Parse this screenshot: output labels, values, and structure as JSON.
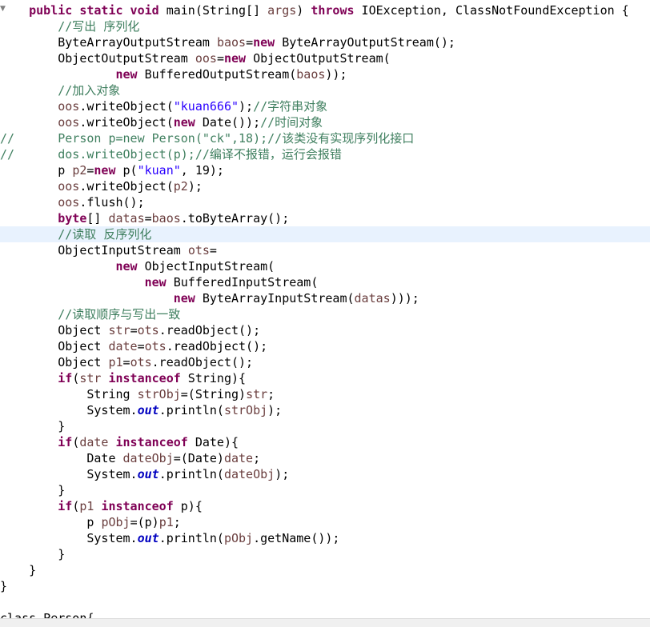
{
  "editor": {
    "fold_icon": "collapse-triangle-icon",
    "current_line": 14,
    "colors": {
      "keyword": "#7f0055",
      "comment": "#3f7f5f",
      "string": "#2a00ff",
      "local_variable": "#6a3e3e",
      "static_field": "#0000c0",
      "current_line_bg": "#e8f2fe"
    },
    "lines": [
      [
        [
          "    ",
          "p"
        ],
        [
          "public static void",
          "k"
        ],
        [
          " main(String[] ",
          "p"
        ],
        [
          "args",
          "v"
        ],
        [
          ") ",
          "p"
        ],
        [
          "throws",
          "k"
        ],
        [
          " IOException, ClassNotFoundException {",
          "p"
        ]
      ],
      [
        [
          "        ",
          "p"
        ],
        [
          "//写出 序列化",
          "c"
        ]
      ],
      [
        [
          "        ByteArrayOutputStream ",
          "p"
        ],
        [
          "baos",
          "v"
        ],
        [
          "=",
          "p"
        ],
        [
          "new",
          "k"
        ],
        [
          " ByteArrayOutputStream();",
          "p"
        ]
      ],
      [
        [
          "        ObjectOutputStream ",
          "p"
        ],
        [
          "oos",
          "v"
        ],
        [
          "=",
          "p"
        ],
        [
          "new",
          "k"
        ],
        [
          " ObjectOutputStream(",
          "p"
        ]
      ],
      [
        [
          "                ",
          "p"
        ],
        [
          "new",
          "k"
        ],
        [
          " BufferedOutputStream(",
          "p"
        ],
        [
          "baos",
          "v"
        ],
        [
          "));",
          "p"
        ]
      ],
      [
        [
          "        ",
          "p"
        ],
        [
          "//加入对象",
          "c"
        ]
      ],
      [
        [
          "        ",
          "p"
        ],
        [
          "oos",
          "v"
        ],
        [
          ".writeObject(",
          "p"
        ],
        [
          "\"kuan666\"",
          "s"
        ],
        [
          ");",
          "p"
        ],
        [
          "//字符串对象",
          "c"
        ]
      ],
      [
        [
          "        ",
          "p"
        ],
        [
          "oos",
          "v"
        ],
        [
          ".writeObject(",
          "p"
        ],
        [
          "new",
          "k"
        ],
        [
          " Date());",
          "p"
        ],
        [
          "//时间对象",
          "c"
        ]
      ],
      [
        [
          "//      Person p=new Person(\"ck\",18);//该类没有实现序列化接口",
          "c"
        ]
      ],
      [
        [
          "//      dos.writeObject(p);//编译不报错，运行会报错",
          "c"
        ]
      ],
      [
        [
          "        p ",
          "p"
        ],
        [
          "p2",
          "v"
        ],
        [
          "=",
          "p"
        ],
        [
          "new",
          "k"
        ],
        [
          " p(",
          "p"
        ],
        [
          "\"kuan\"",
          "s"
        ],
        [
          ", 19);",
          "p"
        ]
      ],
      [
        [
          "        ",
          "p"
        ],
        [
          "oos",
          "v"
        ],
        [
          ".writeObject(",
          "p"
        ],
        [
          "p2",
          "v"
        ],
        [
          ");",
          "p"
        ]
      ],
      [
        [
          "        ",
          "p"
        ],
        [
          "oos",
          "v"
        ],
        [
          ".flush();",
          "p"
        ]
      ],
      [
        [
          "        ",
          "p"
        ],
        [
          "byte",
          "k"
        ],
        [
          "[] ",
          "p"
        ],
        [
          "datas",
          "v"
        ],
        [
          "=",
          "p"
        ],
        [
          "baos",
          "v"
        ],
        [
          ".toByteArray();",
          "p"
        ]
      ],
      [
        [
          "        ",
          "p"
        ],
        [
          "//读取 反序列化",
          "c"
        ]
      ],
      [
        [
          "        ObjectInputStream ",
          "p"
        ],
        [
          "ots",
          "v"
        ],
        [
          "=",
          "p"
        ]
      ],
      [
        [
          "                ",
          "p"
        ],
        [
          "new",
          "k"
        ],
        [
          " ObjectInputStream(",
          "p"
        ]
      ],
      [
        [
          "                    ",
          "p"
        ],
        [
          "new",
          "k"
        ],
        [
          " BufferedInputStream(",
          "p"
        ]
      ],
      [
        [
          "                        ",
          "p"
        ],
        [
          "new",
          "k"
        ],
        [
          " ByteArrayInputStream(",
          "p"
        ],
        [
          "datas",
          "v"
        ],
        [
          ")));",
          "p"
        ]
      ],
      [
        [
          "        ",
          "p"
        ],
        [
          "//读取顺序与写出一致",
          "c"
        ]
      ],
      [
        [
          "        Object ",
          "p"
        ],
        [
          "str",
          "v"
        ],
        [
          "=",
          "p"
        ],
        [
          "ots",
          "v"
        ],
        [
          ".readObject();",
          "p"
        ]
      ],
      [
        [
          "        Object ",
          "p"
        ],
        [
          "date",
          "v"
        ],
        [
          "=",
          "p"
        ],
        [
          "ots",
          "v"
        ],
        [
          ".readObject();",
          "p"
        ]
      ],
      [
        [
          "        Object ",
          "p"
        ],
        [
          "p1",
          "v"
        ],
        [
          "=",
          "p"
        ],
        [
          "ots",
          "v"
        ],
        [
          ".readObject();",
          "p"
        ]
      ],
      [
        [
          "        ",
          "p"
        ],
        [
          "if",
          "k"
        ],
        [
          "(",
          "p"
        ],
        [
          "str",
          "v"
        ],
        [
          " ",
          "p"
        ],
        [
          "instanceof",
          "k"
        ],
        [
          " String){",
          "p"
        ]
      ],
      [
        [
          "            String ",
          "p"
        ],
        [
          "strObj",
          "v"
        ],
        [
          "=(String)",
          "p"
        ],
        [
          "str",
          "v"
        ],
        [
          ";",
          "p"
        ]
      ],
      [
        [
          "            System.",
          "p"
        ],
        [
          "out",
          "f"
        ],
        [
          ".println(",
          "p"
        ],
        [
          "strObj",
          "v"
        ],
        [
          ");",
          "p"
        ]
      ],
      [
        [
          "        }",
          "p"
        ]
      ],
      [
        [
          "        ",
          "p"
        ],
        [
          "if",
          "k"
        ],
        [
          "(",
          "p"
        ],
        [
          "date",
          "v"
        ],
        [
          " ",
          "p"
        ],
        [
          "instanceof",
          "k"
        ],
        [
          " Date){",
          "p"
        ]
      ],
      [
        [
          "            Date ",
          "p"
        ],
        [
          "dateObj",
          "v"
        ],
        [
          "=(Date)",
          "p"
        ],
        [
          "date",
          "v"
        ],
        [
          ";",
          "p"
        ]
      ],
      [
        [
          "            System.",
          "p"
        ],
        [
          "out",
          "f"
        ],
        [
          ".println(",
          "p"
        ],
        [
          "dateObj",
          "v"
        ],
        [
          ");",
          "p"
        ]
      ],
      [
        [
          "        }",
          "p"
        ]
      ],
      [
        [
          "        ",
          "p"
        ],
        [
          "if",
          "k"
        ],
        [
          "(",
          "p"
        ],
        [
          "p1",
          "v"
        ],
        [
          " ",
          "p"
        ],
        [
          "instanceof",
          "k"
        ],
        [
          " p){",
          "p"
        ]
      ],
      [
        [
          "            p ",
          "p"
        ],
        [
          "pObj",
          "v"
        ],
        [
          "=(p)",
          "p"
        ],
        [
          "p1",
          "v"
        ],
        [
          ";",
          "p"
        ]
      ],
      [
        [
          "            System.",
          "p"
        ],
        [
          "out",
          "f"
        ],
        [
          ".println(",
          "p"
        ],
        [
          "pObj",
          "v"
        ],
        [
          ".getName());",
          "p"
        ]
      ],
      [
        [
          "        }",
          "p"
        ]
      ],
      [
        [
          "    }",
          "p"
        ]
      ],
      [
        [
          "}",
          "p"
        ]
      ],
      [
        [
          "",
          "p"
        ]
      ],
      [
        [
          "class Person{",
          "p"
        ]
      ]
    ]
  }
}
